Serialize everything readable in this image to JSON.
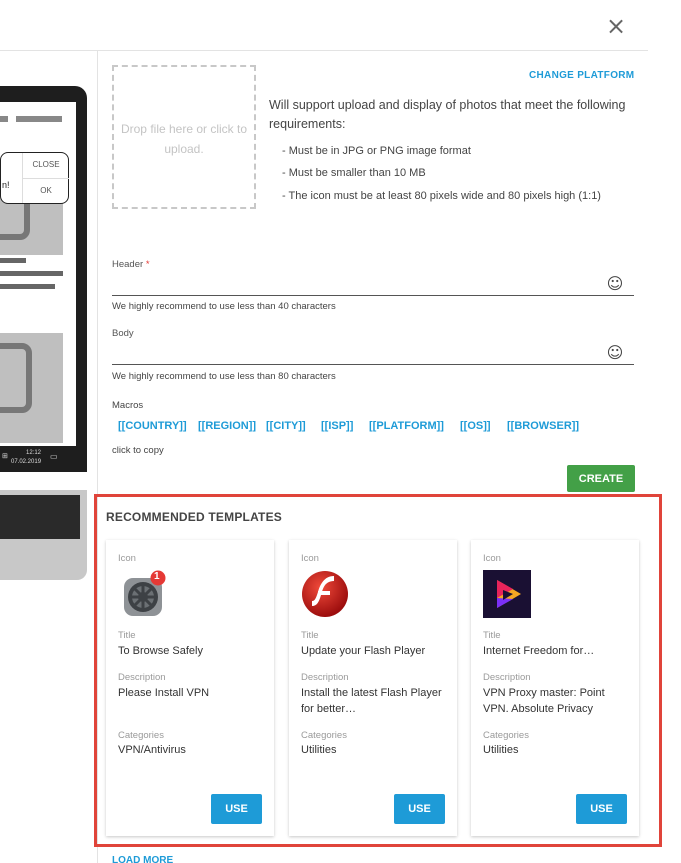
{
  "dialog": {
    "close_glyph": "×"
  },
  "preview": {
    "popup_close": "CLOSE",
    "popup_ok": "OK",
    "popup_text_fragment": "n!",
    "taskbar_time": "12:12",
    "taskbar_date": "07.02.2019"
  },
  "upload": {
    "drop_text": "Drop file here or click to upload.",
    "change_platform": "CHANGE PLATFORM",
    "intro": "Will support upload and display of photos that meet the following requirements:",
    "requirements": [
      "- Must be in JPG or PNG image format",
      "- Must be smaller than 10 MB",
      "- The icon must be at least 80 pixels wide and 80 pixels high (1:1)"
    ]
  },
  "form": {
    "header_label": "Header",
    "required_mark": "*",
    "header_value": "",
    "header_hint": "We highly recommend to use less than 40 characters",
    "body_label": "Body",
    "body_value": "",
    "body_hint": "We highly recommend to use less than 80 characters",
    "emoji_glyph": "☺",
    "macros_label": "Macros",
    "macros": [
      "[[COUNTRY]]",
      "[[REGION]]",
      "[[CITY]]",
      "[[ISP]]",
      "[[PLATFORM]]",
      "[[OS]]",
      "[[BROWSER]]"
    ],
    "click_to_copy": "click to copy",
    "create_label": "CREATE"
  },
  "recommended": {
    "title": "RECOMMENDED TEMPLATES",
    "labels": {
      "icon": "Icon",
      "title": "Title",
      "description": "Description",
      "categories": "Categories",
      "use": "USE"
    },
    "templates": [
      {
        "icon": "settings-gear-icon",
        "badge": "1",
        "title": "To Browse Safely",
        "description": "Please Install VPN",
        "category": "VPN/Antivirus"
      },
      {
        "icon": "flash-player-icon",
        "title": "Update your Flash Player",
        "description": "Install the latest Flash Player for better…",
        "category": "Utilities"
      },
      {
        "icon": "vpn-play-icon",
        "title": "Internet Freedom for…",
        "description": "VPN Proxy master: Point VPN. Absolute Privacy",
        "category": "Utilities"
      }
    ],
    "load_more": "LOAD MORE"
  },
  "colors": {
    "accent": "#1e9bd7",
    "create": "#43a047",
    "highlight": "#e0443a",
    "badge": "#e53935"
  }
}
